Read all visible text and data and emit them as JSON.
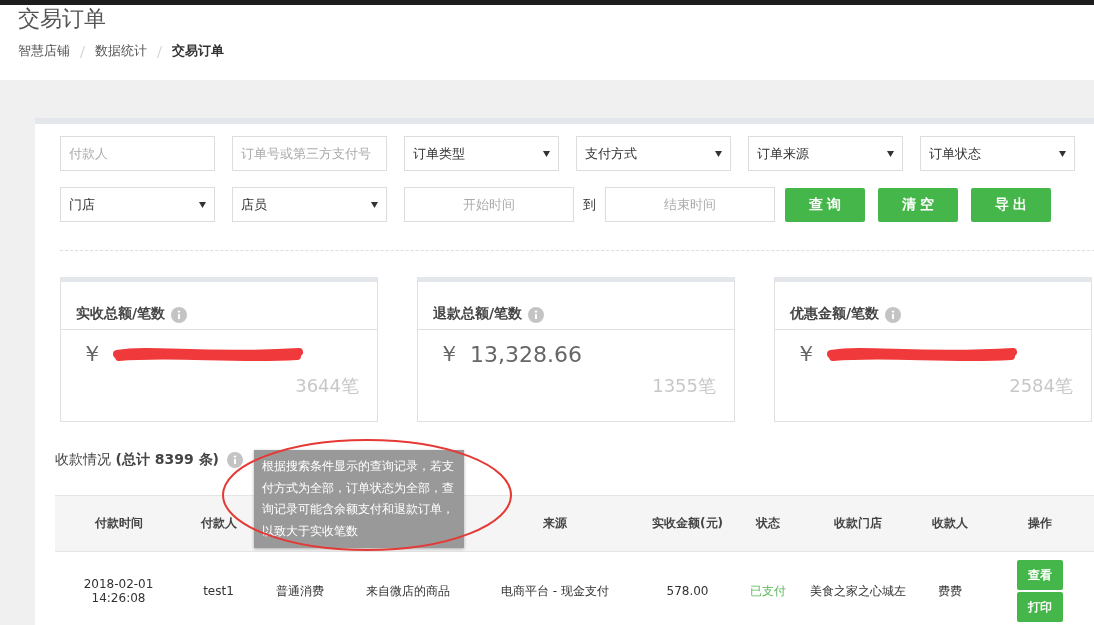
{
  "page_title": "交易订单",
  "breadcrumb": [
    {
      "label": "智慧店铺",
      "current": false
    },
    {
      "label": "数据统计",
      "current": false
    },
    {
      "label": "交易订单",
      "current": true
    }
  ],
  "filters": {
    "row_1": [
      {
        "kind": "text",
        "placeholder": "付款人"
      },
      {
        "kind": "text",
        "placeholder": "订单号或第三方支付号"
      },
      {
        "kind": "select",
        "value": "订单类型"
      },
      {
        "kind": "select",
        "value": "支付方式"
      },
      {
        "kind": "select",
        "value": "订单来源"
      },
      {
        "kind": "select",
        "value": "订单状态"
      }
    ],
    "row_2": [
      {
        "kind": "select",
        "value": "门店"
      },
      {
        "kind": "select",
        "value": "店员"
      },
      {
        "kind": "date",
        "placeholder": "开始时间"
      },
      {
        "kind": "separator",
        "text": "到"
      },
      {
        "kind": "date",
        "placeholder": "结束时间"
      },
      {
        "kind": "button",
        "label": "查 询"
      },
      {
        "kind": "button",
        "label": "清 空"
      },
      {
        "kind": "button",
        "label": "导 出"
      }
    ]
  },
  "stats": [
    {
      "label": "实收总额/笔数",
      "currency": "￥",
      "redacted": true,
      "count": "3644笔"
    },
    {
      "label": "退款总额/笔数",
      "currency": "￥",
      "amount": "13,328.66",
      "redacted": false,
      "count": "1355笔"
    },
    {
      "label": "优惠金额/笔数",
      "currency": "￥",
      "redacted": true,
      "count": "2584笔"
    }
  ],
  "summary": {
    "title": "收款情况 **(总计 8399 条)**"
  },
  "tooltip": {
    "text": "根据搜索条件显示的查询记录，若支付方式为全部，订单状态为全部，查询记录可能含余额支付和退款订单，以致大于实收笔数"
  },
  "table": {
    "columns": [
      {
        "label": "付款时间"
      },
      {
        "label": "付款人"
      },
      {},
      {},
      {
        "label": "来源"
      },
      {
        "label": "实收金额(元)"
      },
      {
        "label": "状态"
      },
      {
        "label": "收款门店"
      },
      {
        "label": "收款人"
      },
      {
        "label": "操作"
      }
    ],
    "rows": [
      {
        "cells": [
          "2018-02-01 14:26:08",
          "test1",
          "普通消费",
          "来自微店的商品",
          "电商平台 - 现金支付",
          "578.00"
        ],
        "status": {
          "text": "已支付",
          "kind": "paid"
        },
        "store": "美食之家之心城左",
        "payee": "费费",
        "actions": [
          "查看",
          "打印"
        ]
      }
    ]
  }
}
